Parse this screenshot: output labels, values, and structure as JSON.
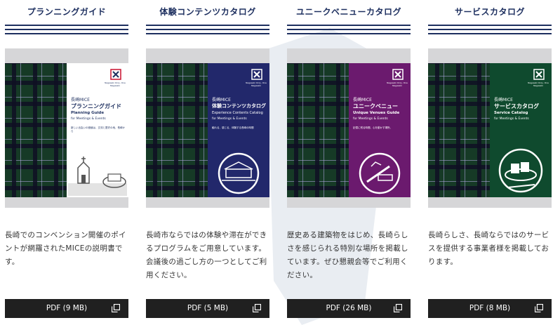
{
  "colors": {
    "navy": "#1d2f5f",
    "planning_panel": "#ffffff",
    "experience_panel": "#22286b",
    "venues_panel": "#6b1a6e",
    "service_panel": "#0f4a2e",
    "button": "#202020"
  },
  "catalogs": [
    {
      "title": "プランニングガイド",
      "cover": {
        "city": "長崎MICE",
        "title_jp": "プランニングガイド",
        "title_en": "Planning Guide",
        "subtitle": "for Meetings & Events",
        "body": "新しい出会いの価値は、交流と歴史の地、長崎から",
        "logo_text": "Nagasaki Only, One Nagasaki",
        "icon": "oura-church-icon"
      },
      "description": "長崎でのコンベンション開催のポイントが網羅されたMICEの説明書です。",
      "pdf_label": "PDF (9 MB)"
    },
    {
      "title": "体験コンテンツカタログ",
      "cover": {
        "city": "長崎MICE",
        "title_jp": "体験コンテンツカタログ",
        "title_en": "Experience Contents Catalog",
        "subtitle": "for Meetings & Events",
        "body": "触れる、感じる、体験する長崎の時間",
        "logo_text": "Nagasaki Only, One Nagasaki",
        "icon": "dejima-icon"
      },
      "description": "長崎市ならではの体験や滞在ができるプログラムをご用意しています。会議後の過ごし方の一つとしてご利用ください。",
      "pdf_label": "PDF (5 MB)"
    },
    {
      "title": "ユニークベニューカタログ",
      "cover": {
        "city": "長崎MICE",
        "title_jp": "ユニークベニュー",
        "title_en": "Unique Venues Guide",
        "subtitle": "for Meetings & Events",
        "body": "記憶に残る時間、心を動かす場所。",
        "logo_text": "Nagasaki Only, One Nagasaki",
        "icon": "unique-venue-icon"
      },
      "description": "歴史ある建築物をはじめ、長崎らしさを感じられる特別な場所を掲載しています。ぜひ懇親会等でご利用ください。",
      "pdf_label": "PDF (26 MB)"
    },
    {
      "title": "サービスカタログ",
      "cover": {
        "city": "長崎MICE",
        "title_jp": "サービスカタログ",
        "title_en": "Service Catalog",
        "subtitle": "for Meetings & Events",
        "body": "",
        "logo_text": "Nagasaki Only, One Nagasaki",
        "icon": "castella-icon"
      },
      "description": "長崎らしさ、長崎ならではのサービスを提供する事業者様を掲載しております。",
      "pdf_label": "PDF (8 MB)"
    }
  ]
}
